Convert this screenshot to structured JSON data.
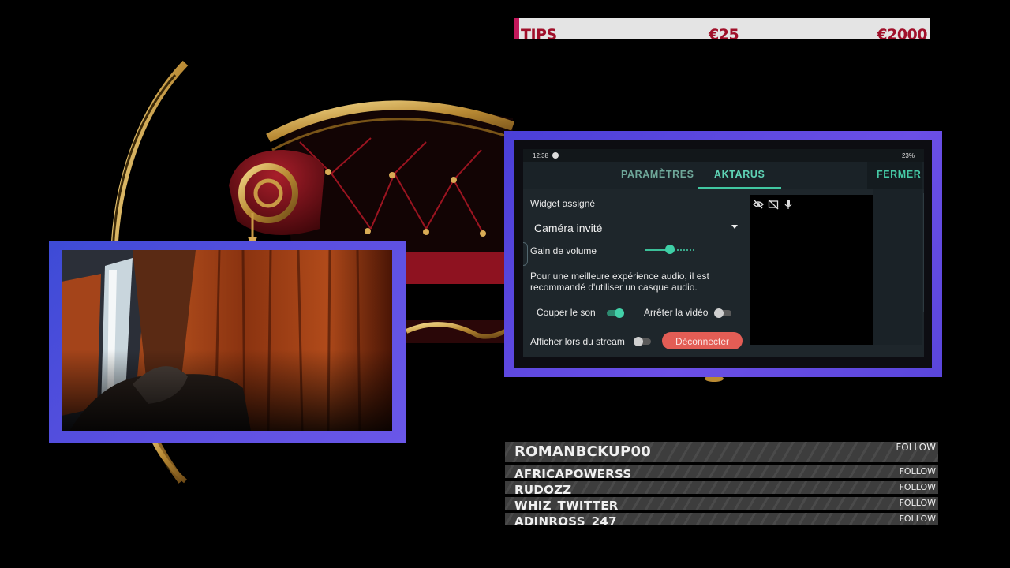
{
  "tips_bar": {
    "label": "TIPS",
    "current": "€25",
    "goal": "€2000"
  },
  "panel": {
    "statusbar": {
      "time": "12:38",
      "indicators": "23%"
    },
    "tabs": [
      {
        "label": "PARAMÈTRES"
      },
      {
        "label": "AKTARUS",
        "active": true
      }
    ],
    "close_label": "FERMER",
    "widget_label": "Widget assigné",
    "widget_value": "Caméra invité",
    "gain_label": "Gain de volume",
    "gain_level": 0.5,
    "advice": "Pour une meilleure expérience audio, il est recommandé d'utiliser un casque audio.",
    "mute_label": "Couper le son",
    "mute_on": true,
    "stop_video_label": "Arrêter la vidéo",
    "stop_video_on": false,
    "show_stream_label": "Afficher lors du stream",
    "show_stream_on": false,
    "disconnect_label": "Déconnecter",
    "preview_icons": [
      "eye-off-icon",
      "camera-off-icon",
      "microphone-icon"
    ],
    "accent_color": "#41c7a1",
    "disconnect_color": "#e35d55"
  },
  "followers": [
    {
      "name": "ROMANBCKUP00",
      "action": "FOLLOW"
    },
    {
      "name": "AFRICAPOWERSS",
      "action": "FOLLOW"
    },
    {
      "name": "RUDOZZ",
      "action": "FOLLOW"
    },
    {
      "name": "WHIZ_TWITTER",
      "action": "FOLLOW"
    },
    {
      "name": "ADINROSS_247",
      "action": "FOLLOW"
    }
  ],
  "frame_color": "#5b4fe0"
}
